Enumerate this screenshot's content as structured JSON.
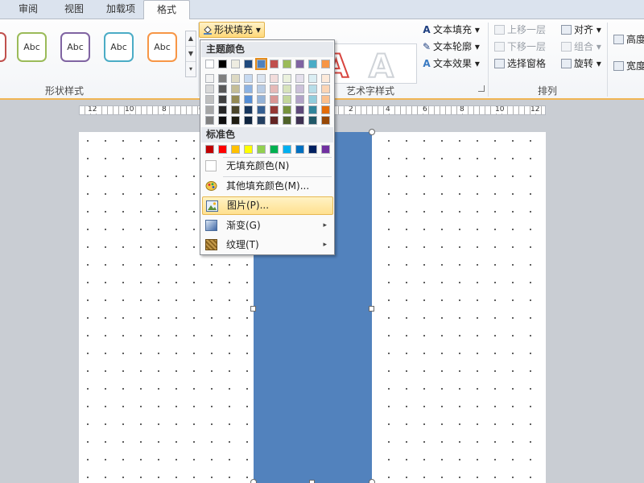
{
  "tabs": [
    {
      "label": "审阅",
      "active": false
    },
    {
      "label": "视图",
      "active": false
    },
    {
      "label": "加载项",
      "active": false
    },
    {
      "label": "格式",
      "active": true
    }
  ],
  "shape_styles": {
    "group_label": "形状样式",
    "presets": [
      {
        "label": "Abc",
        "color": "#9bbb59"
      },
      {
        "label": "Abc",
        "color": "#8064a2"
      },
      {
        "label": "Abc",
        "color": "#4bacc6"
      },
      {
        "label": "Abc",
        "color": "#f79646"
      }
    ],
    "fill_button": "形状填充",
    "dropdown_arrow": "▾"
  },
  "wordart": {
    "group_label": "艺术字样式",
    "text_fill": "文本填充",
    "text_outline": "文本轮廓",
    "text_effects": "文本效果",
    "gallery_glyph": "A"
  },
  "arrange": {
    "group_label": "排列",
    "bring_forward": "上移一层",
    "send_backward": "下移一层",
    "selection_pane": "选择窗格",
    "align": "对齐",
    "group": "组合",
    "rotate": "旋转"
  },
  "size": {
    "height_label": "高度",
    "width_label": "宽度"
  },
  "ruler_marks": [
    {
      "text": "12"
    },
    {
      "text": "10"
    },
    {
      "text": "8"
    },
    {
      "text": "6"
    },
    {
      "text": "4"
    },
    {
      "text": "2"
    },
    {
      "text": "2"
    },
    {
      "text": "4"
    },
    {
      "text": "6"
    },
    {
      "text": "8"
    },
    {
      "text": "10"
    },
    {
      "text": "12"
    }
  ],
  "fill_menu": {
    "theme_colors_label": "标准色",
    "theme_header": "主题颜色",
    "theme_top_row": [
      "#ffffff",
      "#000000",
      "#eeece1",
      "#1f497d",
      "#4f81bd",
      "#c0504d",
      "#9bbb59",
      "#8064a2",
      "#4bacc6",
      "#f79646"
    ],
    "selected_index": 4,
    "theme_shades": [
      [
        "#f2f2f2",
        "#d9d9d9",
        "#bfbfbf",
        "#a6a6a6",
        "#808080"
      ],
      [
        "#7f7f7f",
        "#595959",
        "#404040",
        "#262626",
        "#0d0d0d"
      ],
      [
        "#ddd9c3",
        "#c4bd97",
        "#948a54",
        "#4a452a",
        "#1e1c11"
      ],
      [
        "#c6d9f0",
        "#8db3e2",
        "#548dd4",
        "#17365d",
        "#0f243e"
      ],
      [
        "#dbe5f1",
        "#b8cce4",
        "#95b3d7",
        "#366092",
        "#244061"
      ],
      [
        "#f2dcdb",
        "#e5b9b7",
        "#d99694",
        "#953734",
        "#632423"
      ],
      [
        "#ebf1dd",
        "#d7e3bc",
        "#c3d69b",
        "#76923c",
        "#4f6128"
      ],
      [
        "#e5e0ec",
        "#ccc1d9",
        "#b2a2c7",
        "#5f497a",
        "#3f3151"
      ],
      [
        "#dbeef3",
        "#b7dde8",
        "#92cddc",
        "#31859b",
        "#205867"
      ],
      [
        "#fdeada",
        "#fbd5b5",
        "#fac08f",
        "#e36c09",
        "#974806"
      ]
    ],
    "standard_colors": [
      "#c00000",
      "#ff0000",
      "#ffc000",
      "#ffff00",
      "#92d050",
      "#00b050",
      "#00b0f0",
      "#0070c0",
      "#002060",
      "#7030a0"
    ],
    "items": [
      {
        "label": "无填充颜色(N)",
        "icon": "no-fill-icon"
      },
      {
        "label": "其他填充颜色(M)...",
        "icon": "color-palette-icon"
      },
      {
        "label": "图片(P)...",
        "icon": "picture-icon",
        "highlighted": true
      },
      {
        "label": "渐变(G)",
        "icon": "gradient-icon",
        "submenu": true
      },
      {
        "label": "纹理(T)",
        "icon": "texture-icon",
        "submenu": true
      }
    ],
    "submenu_arrow": "▸"
  },
  "colors": {
    "shape_fill": "#5282bd",
    "ribbon_accent": "#f0b553",
    "menu_highlight": "#ffe08f"
  }
}
